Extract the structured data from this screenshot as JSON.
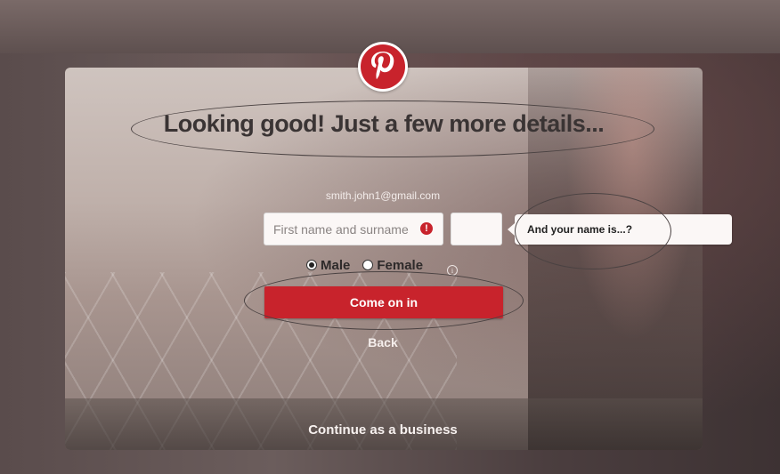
{
  "brand": {
    "logo_icon": "pinterest-logo-icon",
    "accent_color": "#c8232c"
  },
  "signup": {
    "headline": "Looking good! Just a few more details...",
    "email": "smith.john1@gmail.com",
    "name_placeholder": "First name and surname",
    "age_value": "",
    "tooltip": "And your name is...?",
    "gender": {
      "options": [
        "Male",
        "Female"
      ],
      "selected": "Male"
    },
    "submit_label": "Come on in",
    "back_label": "Back"
  },
  "footer": {
    "business_label": "Continue as a business"
  }
}
